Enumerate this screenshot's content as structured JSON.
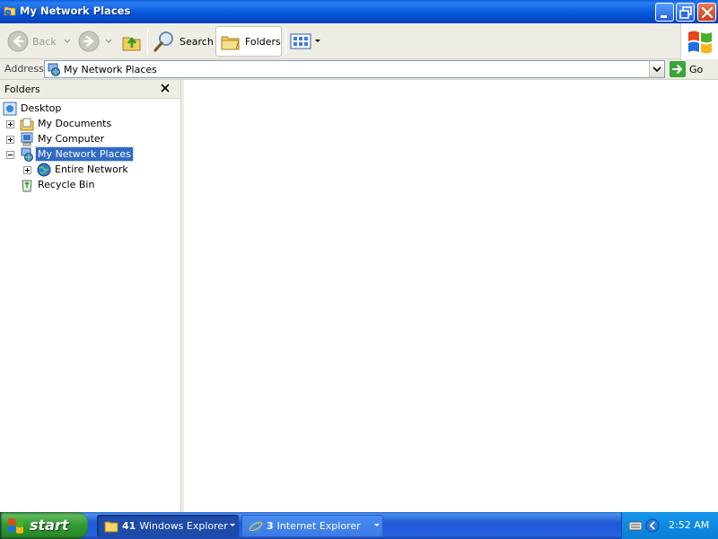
{
  "window": {
    "title": "My Network Places"
  },
  "toolbar": {
    "back_label": "Back",
    "search_label": "Search",
    "folders_label": "Folders"
  },
  "address": {
    "label": "Address",
    "value": "My Network Places",
    "go_label": "Go"
  },
  "folders_pane": {
    "title": "Folders",
    "tree": [
      {
        "label": "Desktop"
      },
      {
        "label": "My Documents"
      },
      {
        "label": "My Computer"
      },
      {
        "label": "My Network Places",
        "selected": true
      },
      {
        "label": "Entire Network"
      },
      {
        "label": "Recycle Bin"
      }
    ]
  },
  "taskbar": {
    "start_label": "start",
    "groups": [
      {
        "count": "41",
        "label": "Windows Explorer",
        "active": true
      },
      {
        "count": "3",
        "label": "Internet Explorer",
        "active": false
      }
    ],
    "clock": "2:52 AM"
  }
}
